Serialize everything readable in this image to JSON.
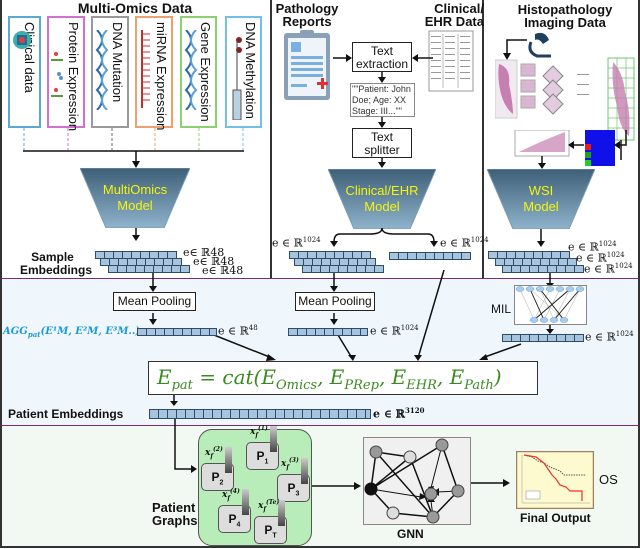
{
  "sections": {
    "multi_omics": {
      "title": "Multi-Omics Data",
      "cards": [
        {
          "label": "Clinical data",
          "color": "#5aa8d8",
          "icon": "clinical-folder-icon"
        },
        {
          "label": "Protein Expression",
          "color": "#d070d0",
          "icon": "protein-icon"
        },
        {
          "label": "DNA Mutation",
          "color": "#999999",
          "icon": "dna-mutation-icon"
        },
        {
          "label": "miRNA Expression",
          "color": "#f0a070",
          "icon": "mirna-icon"
        },
        {
          "label": "Gene Expression",
          "color": "#8cd070",
          "icon": "gene-icon"
        },
        {
          "label": "DNA Methylation",
          "color": "#70c0e8",
          "icon": "methylation-icon"
        }
      ],
      "model_line1": "MultiOmics",
      "model_line2": "Model",
      "embedding_label_line1": "Sample",
      "embedding_label_line2": "Embeddings",
      "embedding_dims": [
        "e∈ ℝ48",
        "e∈ ℝ48",
        "e∈ ℝ48"
      ]
    },
    "pathology": {
      "title_line1": "Pathology",
      "title_line2": "Reports",
      "ehr_title_line1": "Clinical/",
      "ehr_title_line2": "EHR Data",
      "text_extraction_line1": "Text",
      "text_extraction_line2": "extraction",
      "sample_text_line1": "\"\"Patient: John",
      "sample_text_line2": "Doe;  Age: XX",
      "sample_text_line3": "Stage: III...\"\"",
      "text_splitter_line1": "Text",
      "text_splitter_line2": "splitter",
      "model_line1": "Clinical/EHR",
      "model_line2": "Model",
      "dim_left": "e ∈ ℝ",
      "dim_left_sup": "1024",
      "dim_right": "e ∈ ℝ",
      "dim_right_sup": "1024"
    },
    "histopathology": {
      "title_line1": "Histopathology",
      "title_line2": "Imaging Data",
      "model_line1": "WSI",
      "model_line2": "Model",
      "dims": [
        "e ∈ ℝ",
        "e ∈ ℝ",
        "e ∈ ℝ"
      ],
      "dim_sup": "1024"
    }
  },
  "aggregation": {
    "mean_pooling_1": "Mean Pooling",
    "mean_pooling_2": "Mean Pooling",
    "agg_formula": "AGG",
    "agg_sub": "pat",
    "agg_args": "(E¹M, E²M, E³M..):",
    "dim_omics": "e ∈ ℝ",
    "dim_omics_sup": "48",
    "dim_prep": "e ∈ ℝ",
    "dim_prep_sup": "1024",
    "mil_label": "MIL",
    "dim_mil": "e ∈ ℝ",
    "dim_mil_sup": "1024",
    "formula": "E_pat = cat(E_Omics, E_PRep, E_EHR, E_Path)",
    "patient_embeddings_label": "Patient Embeddings",
    "dim_patient": "e ∈ ℝ",
    "dim_patient_sup": "3120"
  },
  "graph": {
    "patient_graphs_line1": "Patient",
    "patient_graphs_line2": "Graphs",
    "patients": [
      {
        "name": "P",
        "sub": "1",
        "feat": "(1)"
      },
      {
        "name": "P",
        "sub": "2",
        "feat": "(2)"
      },
      {
        "name": "P",
        "sub": "3",
        "feat": "(3)"
      },
      {
        "name": "P",
        "sub": "4",
        "feat": "(4)"
      },
      {
        "name": "P",
        "sub": "T",
        "feat": "(Te)"
      }
    ],
    "gnn_label": "GNN",
    "final_output_label": "Final Output",
    "os_label": "OS"
  },
  "colors": {
    "section_divider": "#7a2a7a",
    "aggregation_bg": "#f0f7fc",
    "graph_bg": "#f2f8f2",
    "formula_green": "#3a8a20",
    "agg_blue": "#1a9ad8",
    "model_text": "#f5f50a",
    "patient_graph_bg": "#b8ecb8"
  }
}
